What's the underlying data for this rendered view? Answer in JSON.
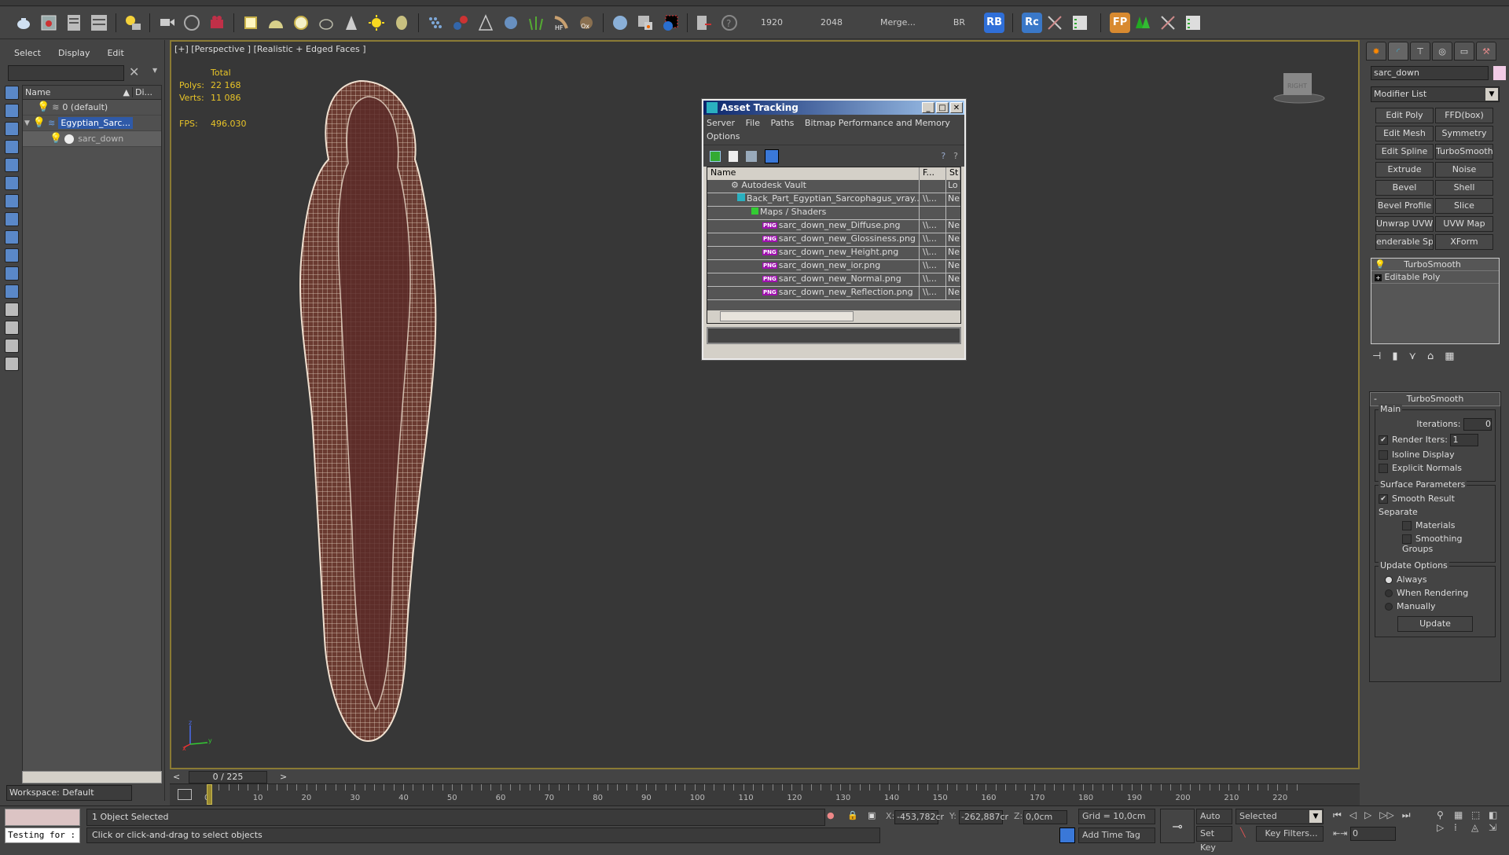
{
  "toolbar": {
    "field_1920": "1920",
    "field_2048": "2048",
    "merge_label": "Merge...",
    "br_label": "BR",
    "rb_badge": "RB",
    "rc_badge": "Rc",
    "fp_badge": "FP",
    "icons": [
      "teapot-render-icon",
      "render-frame-icon",
      "render-setup-icon",
      "render-settings-icon",
      "light-lister-icon",
      "camera-icon",
      "camera-half-icon",
      "camera-record-icon",
      "plane-light-icon",
      "dome-light-icon",
      "sphere-light-icon",
      "teapot-wire-icon",
      "cone-icon",
      "sun-icon",
      "sphere-mesh-icon",
      "scatter-icon",
      "molecule-icon",
      "tower-icon",
      "gear-sphere-icon",
      "grass-icon",
      "hair-hf-icon",
      "fur-ox-icon",
      "sphere-icon",
      "material-editor-icon",
      "vray-framebuffer-icon",
      "import-icon",
      "help-icon"
    ]
  },
  "scene_explorer": {
    "menu": [
      "Select",
      "Display",
      "Edit"
    ],
    "search_value": "",
    "columns": {
      "name": "Name",
      "display": "Di..."
    },
    "items": [
      {
        "label": "0 (default)",
        "type": "layer",
        "selected": false
      },
      {
        "label": "Egyptian_Sarc...",
        "type": "layer",
        "selected": true
      },
      {
        "label": "sarc_down",
        "type": "object",
        "selected": false
      }
    ],
    "workspace": "Workspace: Default"
  },
  "viewport": {
    "label": "[+] [Perspective ] [Realistic + Edged Faces ]",
    "stats_header": "Total",
    "polys_label": "Polys:",
    "polys_value": "22 168",
    "verts_label": "Verts:",
    "verts_value": "11 086",
    "fps_label": "FPS:",
    "fps_value": "496.030",
    "viewcube_label": "RIGHT",
    "axis_labels": [
      "z",
      "y",
      "x"
    ]
  },
  "asset_tracking": {
    "title": "Asset Tracking",
    "menu": [
      "Server",
      "File",
      "Paths",
      "Bitmap Performance and Memory",
      "Options"
    ],
    "columns": [
      "Name",
      "F...",
      "St"
    ],
    "rows": [
      {
        "name": "Autodesk Vault",
        "f": "",
        "s": "Lo",
        "indent": 1,
        "icon": "vault-icon"
      },
      {
        "name": "Back_Part_Egyptian_Sarcophagus_vray....",
        "f": "\\\\...",
        "s": "Ne",
        "indent": 2,
        "icon": "max-file-icon"
      },
      {
        "name": "Maps / Shaders",
        "f": "",
        "s": "",
        "indent": 3,
        "icon": "maps-icon"
      },
      {
        "name": "sarc_down_new_Diffuse.png",
        "f": "\\\\...",
        "s": "Ne",
        "indent": 4,
        "icon": "png-icon"
      },
      {
        "name": "sarc_down_new_Glossiness.png",
        "f": "\\\\...",
        "s": "Ne",
        "indent": 4,
        "icon": "png-icon"
      },
      {
        "name": "sarc_down_new_Height.png",
        "f": "\\\\...",
        "s": "Ne",
        "indent": 4,
        "icon": "png-icon"
      },
      {
        "name": "sarc_down_new_ior.png",
        "f": "\\\\...",
        "s": "Ne",
        "indent": 4,
        "icon": "png-icon"
      },
      {
        "name": "sarc_down_new_Normal.png",
        "f": "\\\\...",
        "s": "Ne",
        "indent": 4,
        "icon": "png-icon"
      },
      {
        "name": "sarc_down_new_Reflection.png",
        "f": "\\\\...",
        "s": "Ne",
        "indent": 4,
        "icon": "png-icon"
      }
    ],
    "png_badge": "PNG"
  },
  "command_panel": {
    "object_name": "sarc_down",
    "object_color": "#f2cbe6",
    "modifier_list": "Modifier List",
    "modifier_buttons": [
      "Edit Poly",
      "FFD(box)",
      "Edit Mesh",
      "Symmetry",
      "Edit Spline",
      "TurboSmooth",
      "Extrude",
      "Noise",
      "Bevel",
      "Shell",
      "Bevel Profile",
      "Slice",
      "Unwrap UVW",
      "UVW Map",
      "enderable Splin",
      "XForm"
    ],
    "stack": [
      "TurboSmooth",
      "Editable Poly"
    ],
    "rollout": {
      "title": "TurboSmooth",
      "collapse": "-",
      "main_label": "Main",
      "iterations_label": "Iterations:",
      "iterations_value": "0",
      "render_iters_label": "Render Iters:",
      "render_iters_value": "1",
      "render_iters_checked": true,
      "isoline_label": "Isoline Display",
      "explicit_normals_label": "Explicit Normals",
      "surface_label": "Surface Parameters",
      "smooth_result_label": "Smooth Result",
      "separate_label": "Separate",
      "materials_label": "Materials",
      "smoothing_groups_label": "Smoothing Groups",
      "update_options_label": "Update Options",
      "always_label": "Always",
      "when_rendering_label": "When Rendering",
      "manually_label": "Manually",
      "update_button": "Update"
    }
  },
  "timeline": {
    "slider_label": "0 / 225",
    "prev": "<",
    "next": ">",
    "ticks": [
      "0",
      "10",
      "20",
      "30",
      "40",
      "50",
      "60",
      "70",
      "80",
      "90",
      "100",
      "110",
      "120",
      "130",
      "140",
      "150",
      "160",
      "170",
      "180",
      "190",
      "200",
      "210",
      "220"
    ]
  },
  "statusbar": {
    "maxscript_value": "Testing for :",
    "selection_status": "1 Object Selected",
    "prompt": "Click or click-and-drag to select objects",
    "x_label": "X:",
    "x_value": "-453,782cr",
    "y_label": "Y:",
    "y_value": "-262,887cr",
    "z_label": "Z:",
    "z_value": "0,0cm",
    "grid": "Grid = 10,0cm",
    "add_time_tag": "Add Time Tag",
    "auto_key": "Auto Key",
    "set_key": "Set Key",
    "key_mode": "Selected",
    "key_filters": "Key Filters...",
    "frame_value": "0"
  }
}
